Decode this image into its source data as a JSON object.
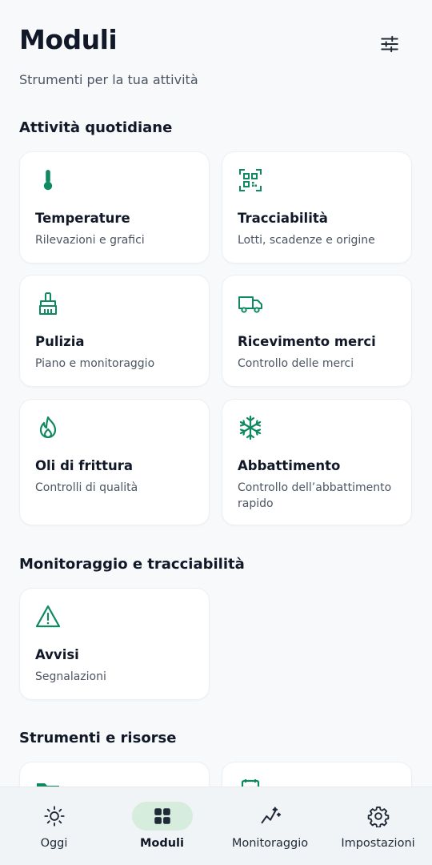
{
  "header": {
    "title": "Moduli",
    "subtitle": "Strumenti per la tua attività"
  },
  "sections": [
    {
      "title": "Attività quotidiane",
      "cards": [
        {
          "title": "Temperature",
          "desc": "Rilevazioni e grafici",
          "icon": "thermometer-icon"
        },
        {
          "title": "Tracciabilità",
          "desc": "Lotti, scadenze e origine",
          "icon": "qr-code-icon"
        },
        {
          "title": "Pulizia",
          "desc": "Piano e monitoraggio",
          "icon": "broom-icon"
        },
        {
          "title": "Ricevimento merci",
          "desc": "Controllo delle merci",
          "icon": "truck-icon"
        },
        {
          "title": "Oli di frittura",
          "desc": "Controlli di qualità",
          "icon": "flame-icon"
        },
        {
          "title": "Abbattimento",
          "desc": "Controllo dell’abbattimento rapido",
          "icon": "snowflake-icon"
        }
      ]
    },
    {
      "title": "Monitoraggio e tracciabilità",
      "cards": [
        {
          "title": "Avvisi",
          "desc": "Segnalazioni",
          "icon": "warning-icon"
        }
      ]
    },
    {
      "title": "Strumenti e risorse",
      "cards": []
    }
  ],
  "nav": [
    {
      "label": "Oggi",
      "icon": "sun-icon",
      "active": false
    },
    {
      "label": "Moduli",
      "icon": "grid-icon",
      "active": true
    },
    {
      "label": "Monitoraggio",
      "icon": "chart-line-icon",
      "active": false
    },
    {
      "label": "Impostazioni",
      "icon": "gear-icon",
      "active": false
    }
  ],
  "colors": {
    "accent": "#0f8a5f",
    "nav_active_bg": "#d6ecdc",
    "background": "#f7f9fb"
  }
}
